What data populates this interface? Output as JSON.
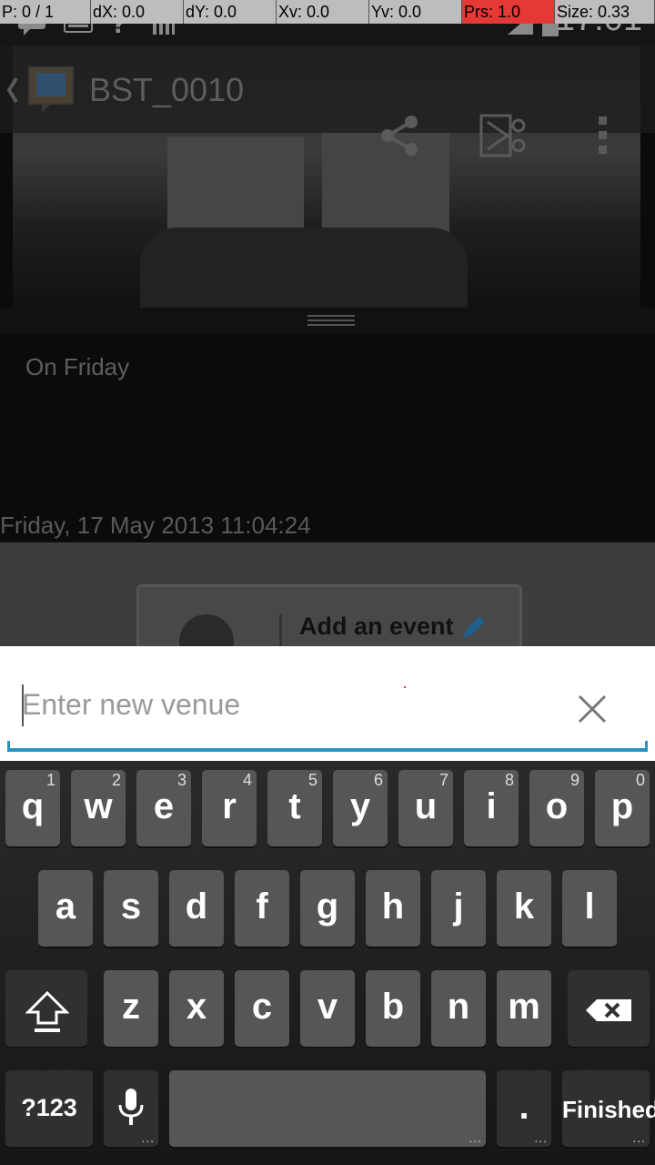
{
  "debug": {
    "p": "P: 0 / 1",
    "dx": "dX: 0.0",
    "dy": "dY: 0.0",
    "xv": "Xv: 0.0",
    "yv": "Yv: 0.0",
    "prs": "Prs: 1.0",
    "size": "Size: 0.33"
  },
  "status": {
    "time": "17:01"
  },
  "app": {
    "title": "BST_0010",
    "caption": "On Friday",
    "datetime": "Friday, 17 May 2013 11:04:24",
    "event_label": "Add an event"
  },
  "venue": {
    "placeholder": "Enter new venue",
    "value": ""
  },
  "keyboard": {
    "row1": [
      {
        "k": "q",
        "h": "1"
      },
      {
        "k": "w",
        "h": "2"
      },
      {
        "k": "e",
        "h": "3"
      },
      {
        "k": "r",
        "h": "4"
      },
      {
        "k": "t",
        "h": "5"
      },
      {
        "k": "y",
        "h": "6"
      },
      {
        "k": "u",
        "h": "7"
      },
      {
        "k": "i",
        "h": "8"
      },
      {
        "k": "o",
        "h": "9"
      },
      {
        "k": "p",
        "h": "0"
      }
    ],
    "row2": [
      "a",
      "s",
      "d",
      "f",
      "g",
      "h",
      "j",
      "k",
      "l"
    ],
    "row3": [
      "z",
      "x",
      "c",
      "v",
      "b",
      "n",
      "m"
    ],
    "symbols": "?123",
    "period": ".",
    "action": "Finished",
    "ellipsis": "..."
  },
  "colors": {
    "accent": "#2a93c4",
    "key": "#565656",
    "keyboard_bg": "#1e1e1e"
  }
}
